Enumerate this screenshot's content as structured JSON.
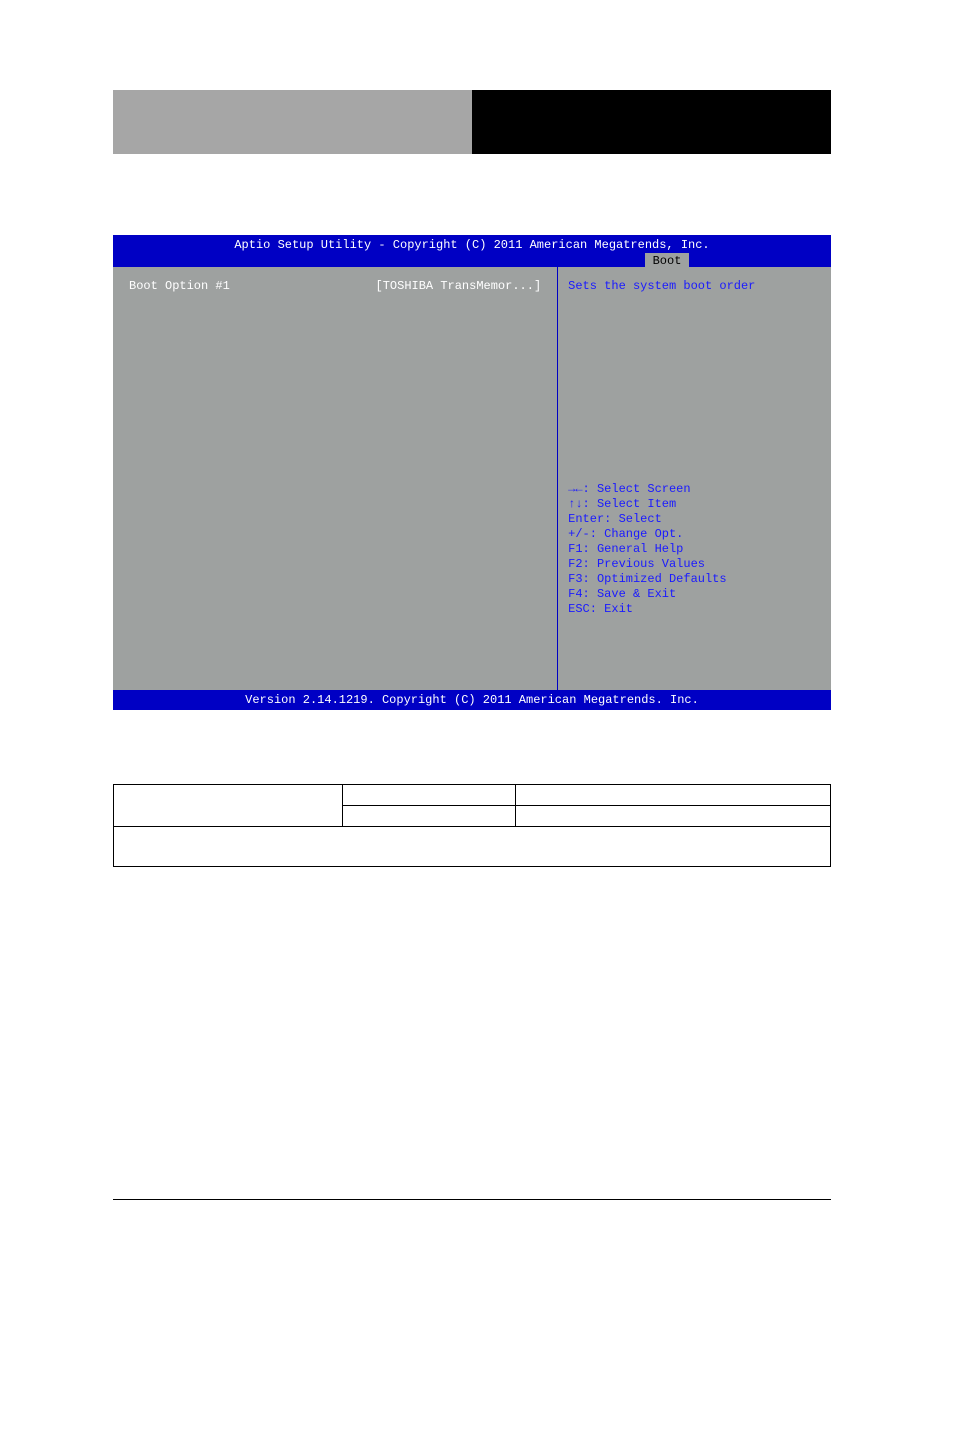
{
  "bios": {
    "title_line1": "Aptio Setup Utility - Copyright (C) 2011 American Megatrends, Inc.",
    "tab": "Boot",
    "left": {
      "option_label": "Boot Option #1",
      "option_value": "[TOSHIBA TransMemor...]"
    },
    "right": {
      "description": "Sets the system boot order",
      "help": {
        "l1": "→←: Select Screen",
        "l2": "↑↓: Select Item",
        "l3": "Enter: Select",
        "l4": "+/-: Change Opt.",
        "l5": "F1: General Help",
        "l6": "F2: Previous Values",
        "l7": "F3: Optimized Defaults",
        "l8": "F4: Save & Exit",
        "l9": "ESC: Exit"
      }
    },
    "footer": "Version 2.14.1219. Copyright (C) 2011 American Megatrends. Inc."
  },
  "table": {
    "row1": {
      "label": "",
      "value": "",
      "desc": ""
    },
    "row2": {
      "label": "",
      "value": "",
      "desc": ""
    },
    "row3": {
      "merged": ""
    }
  }
}
